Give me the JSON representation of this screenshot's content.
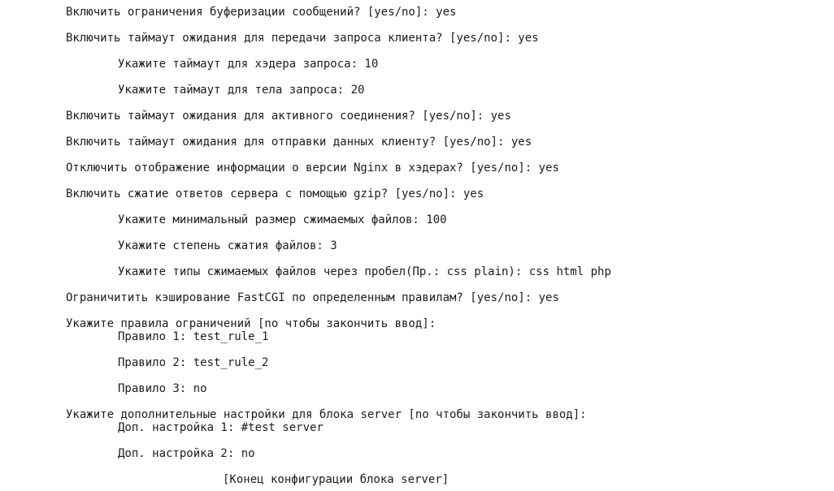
{
  "terminal": {
    "lines": [
      "Включить ограничения буферизации сообщений? [yes/no]: yes",
      "Включить таймаут ожидания для передачи запроса клиента? [yes/no]: yes",
      "Укажите таймаут для хэдера запроса: 10",
      "Укажите таймаут для тела запроса: 20",
      "Включить таймаут ожидания для активного соединения? [yes/no]: yes",
      "Включить таймаут ожидания для отправки данных клиенту? [yes/no]: yes",
      "Отключить отображение информации о версии Nginx в хэдерах? [yes/no]: yes",
      "Включить сжатие ответов сервера с помощью gzip? [yes/no]: yes",
      "Укажите минимальный размер сжимаемых файлов: 100",
      "Укажите степень сжатия файлов: 3",
      "Укажите типы сжимаемых файлов через пробел(Пр.: css plain): css html php",
      "Ограничитить кэширование FastCGI по определенным правилам? [yes/no]: yes",
      "Укажите правила ограничений [no чтобы закончить ввод]:",
      "Правило 1: test_rule_1",
      "Правило 2: test_rule_2",
      "Правило 3: no",
      "Укажите дополнительные настройки для блока server [no чтобы закончить ввод]:",
      "Доп. настройка 1: #test server",
      "Доп. настройка 2: no",
      "[Конец конфигурации блока server]"
    ]
  }
}
